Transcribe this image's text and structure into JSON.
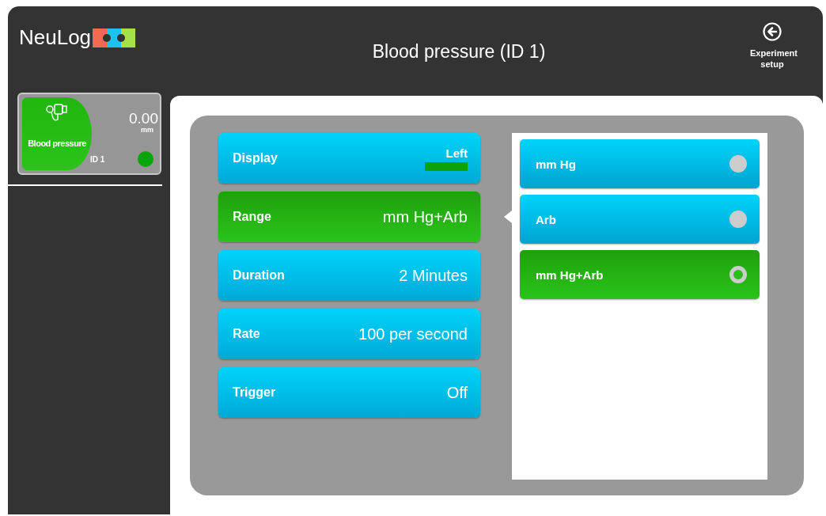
{
  "header": {
    "logo": "NeuLog",
    "title": "Blood pressure (ID 1)",
    "setup_button": "Experiment setup"
  },
  "sensor": {
    "name": "Blood pressure",
    "reading": "0.00",
    "unit": "mm",
    "id": "ID 1"
  },
  "settings": [
    {
      "kind": "display",
      "label": "Display",
      "value": "Left",
      "selected": false
    },
    {
      "kind": "value",
      "label": "Range",
      "value": "mm Hg+Arb",
      "selected": true
    },
    {
      "kind": "value",
      "label": "Duration",
      "value": "2 Minutes",
      "selected": false
    },
    {
      "kind": "value",
      "label": "Rate",
      "value": "100 per second",
      "selected": false
    },
    {
      "kind": "value",
      "label": "Trigger",
      "value": "Off",
      "selected": false
    }
  ],
  "options": [
    {
      "label": "mm Hg",
      "selected": false
    },
    {
      "label": "Arb",
      "selected": false
    },
    {
      "label": "mm Hg+Arb",
      "selected": true
    }
  ]
}
